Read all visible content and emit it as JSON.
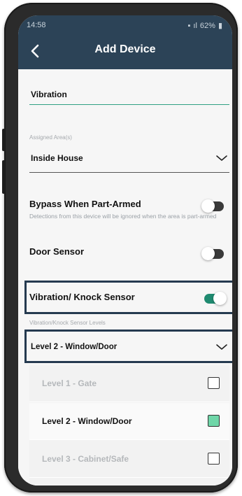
{
  "status": {
    "time": "14:58",
    "battery": "62%"
  },
  "header": {
    "title": "Add Device"
  },
  "device_name": {
    "value": "Vibration"
  },
  "assigned_area": {
    "label": "Assigned Area(s)",
    "value": "Inside House"
  },
  "settings": {
    "bypass": {
      "name": "Bypass When Part-Armed",
      "description": "Detections from this device will be ignored when the area is part-armed",
      "enabled": false
    },
    "door_sensor": {
      "name": "Door Sensor",
      "enabled": false
    },
    "vibration_knock": {
      "name": "Vibration/ Knock Sensor",
      "enabled": true
    }
  },
  "levels": {
    "label": "Vibration/Knock Sensor Levels",
    "selected": "Level 2 - Window/Door",
    "options": [
      {
        "label": "Level 1 - Gate",
        "checked": false
      },
      {
        "label": "Level 2 - Window/Door",
        "checked": true
      },
      {
        "label": "Level 3 - Cabinet/Safe",
        "checked": false
      }
    ]
  },
  "colors": {
    "header": "#2c4357",
    "accent": "#1f8a70",
    "highlight": "#253a50"
  }
}
